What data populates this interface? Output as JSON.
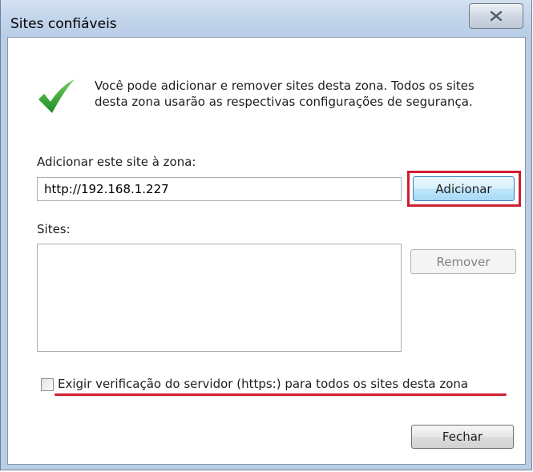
{
  "window": {
    "title": "Sites confiáveis"
  },
  "intro": {
    "text": "Você pode adicionar e remover sites desta zona. Todos os sites desta zona usarão as respectivas configurações de segurança."
  },
  "add_site": {
    "label": "Adicionar este site à zona:",
    "input_value": "http://192.168.1.227",
    "button_label": "Adicionar"
  },
  "sites": {
    "label": "Sites:",
    "items": [],
    "remove_label": "Remover"
  },
  "https_option": {
    "label": "Exigir verificação do servidor (https:) para todos os sites desta zona",
    "checked": false
  },
  "footer": {
    "close_label": "Fechar"
  },
  "colors": {
    "highlight": "#d01f2e",
    "checkmark": "#2e9a2e"
  },
  "icons": {
    "title_close": "close-icon",
    "intro": "checkmark-icon"
  }
}
